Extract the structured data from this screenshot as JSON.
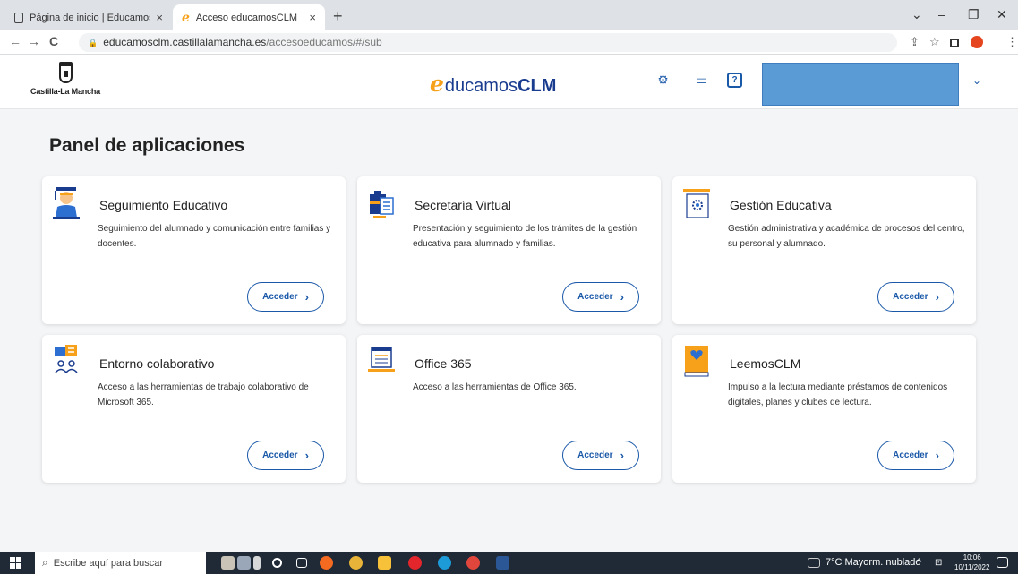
{
  "browser": {
    "tabs": [
      {
        "title": "Página de inicio | EducamosCLM",
        "close": "×"
      },
      {
        "title": "Acceso educamosCLM",
        "close": "×"
      }
    ],
    "new_tab": "+",
    "window_controls": {
      "minimize": "–",
      "maximize": "❐",
      "close": "✕",
      "tab_search": "⌄"
    },
    "nav": {
      "back": "←",
      "forward": "→",
      "reload": "C"
    },
    "url_host": "educamosclm.castillalamancha.es",
    "url_path": "/accesoeducamos/#/sub",
    "omnibox_icons": {
      "share": "⇪",
      "bookmark": "☆",
      "more": "⋮"
    }
  },
  "site": {
    "jccm_name": "Castilla-La Mancha",
    "brand_main": "ducamos",
    "brand_bold": "CLM",
    "brand_e": "e",
    "header_icons": {
      "settings": "⚙",
      "desktop": "▭",
      "help": "?"
    },
    "user_chevron": "⌄"
  },
  "panel": {
    "title": "Panel de aplicaciones",
    "button_label": "Acceder",
    "button_chevron": "›",
    "cards": [
      {
        "title": "Seguimiento Educativo",
        "desc": "Seguimiento del alumnado y comunicación entre familias y docentes."
      },
      {
        "title": "Secretaría Virtual",
        "desc": "Presentación y seguimiento de los trámites de la gestión educativa para alumnado y familias."
      },
      {
        "title": "Gestión Educativa",
        "desc": "Gestión administrativa y académica de procesos del centro, su personal y alumnado."
      },
      {
        "title": "Entorno colaborativo",
        "desc": "Acceso a las herramientas de trabajo colaborativo de Microsoft 365."
      },
      {
        "title": "Office 365",
        "desc": "Acceso a las herramientas de Office 365."
      },
      {
        "title": "LeemosCLM",
        "desc": "Impulso a la lectura mediante préstamos de contenidos digitales, planes y clubes de lectura."
      }
    ]
  },
  "taskbar": {
    "search_placeholder": "Escribe aquí para buscar",
    "weather": "7°C  Mayorm. nublado",
    "tray_chevron": "^",
    "time": "10:06",
    "date": "10/11/2022"
  }
}
